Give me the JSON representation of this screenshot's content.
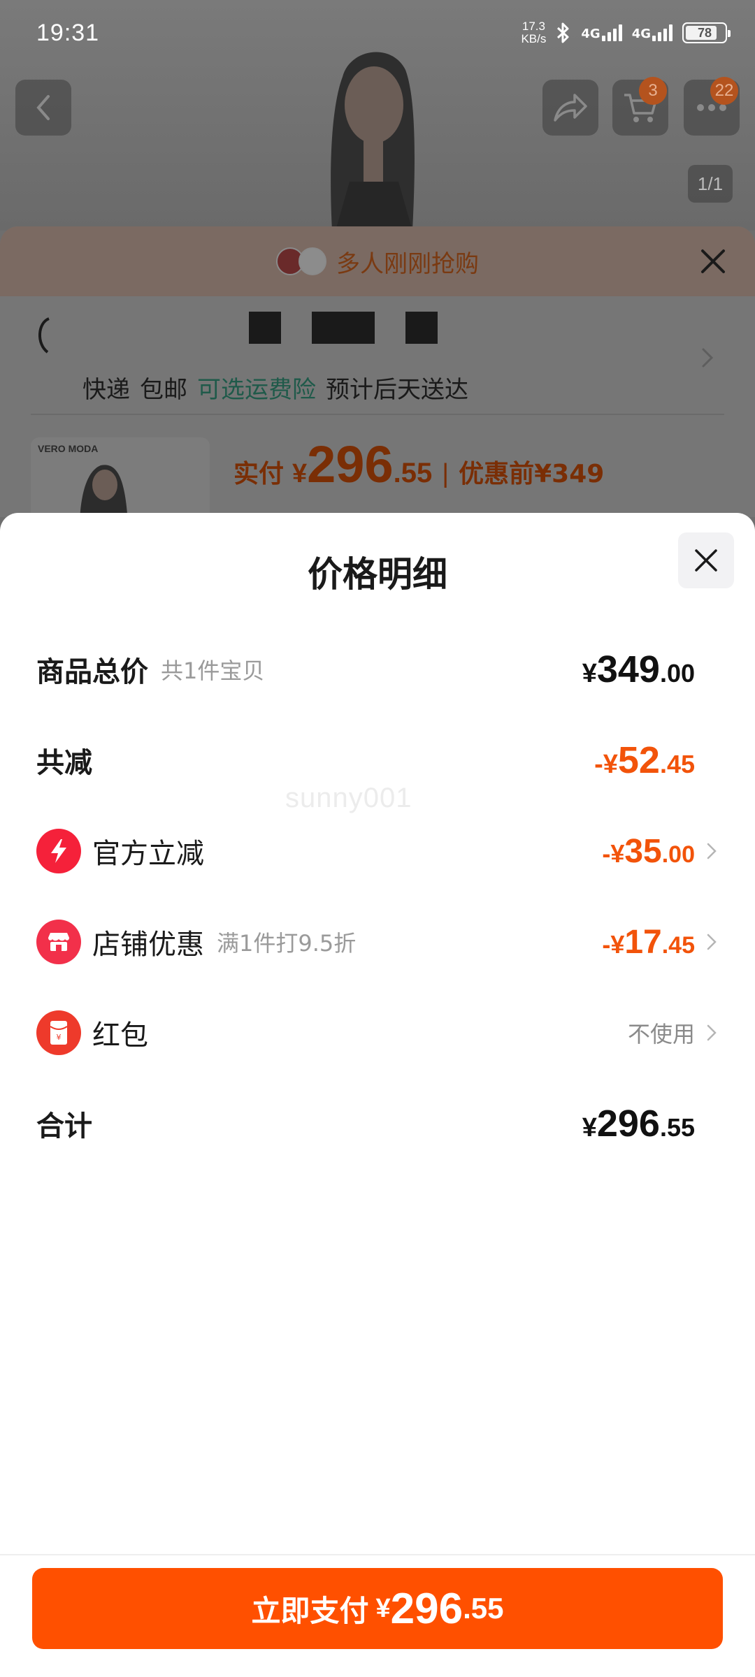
{
  "status_bar": {
    "time": "19:31",
    "net_speed_value": "17.3",
    "net_speed_unit": "KB/s",
    "sim1": "4G",
    "sim2": "4G",
    "battery": "78"
  },
  "product_page": {
    "cart_badge": "3",
    "message_badge": "22",
    "image_indicator": "1/1",
    "promo_text": "多人刚刚抢购",
    "shipping": {
      "method": "快递",
      "free_shipping": "包邮",
      "insurance_link": "可选运费险",
      "eta": "预计后天送达"
    },
    "thumb_brand": "VERO MODA",
    "price": {
      "label": "实付",
      "currency": "¥",
      "integer": "296",
      "decimal": ".55",
      "separator": "|",
      "original": "优惠前¥349"
    }
  },
  "sheet": {
    "title": "价格明细",
    "watermark": "sunny001",
    "rows": [
      {
        "label": "商品总价",
        "sub": "共1件宝贝",
        "currency": "¥",
        "integer": "349",
        "decimal": ".00"
      },
      {
        "label": "共减",
        "currency": "-¥",
        "integer": "52",
        "decimal": ".45"
      },
      {
        "label": "官方立减",
        "icon": "lightning-icon",
        "currency": "-¥",
        "integer": "35",
        "decimal": ".00"
      },
      {
        "label": "店铺优惠",
        "sub": "满1件打9.5折",
        "icon": "store-icon",
        "currency": "-¥",
        "integer": "17",
        "decimal": ".45"
      },
      {
        "label": "红包",
        "icon": "red-packet-icon",
        "value": "不使用"
      },
      {
        "label": "合计",
        "currency": "¥",
        "integer": "296",
        "decimal": ".55"
      }
    ],
    "pay_button": {
      "label": "立即支付",
      "currency": "¥",
      "integer": "296",
      "decimal": ".55"
    }
  },
  "colors": {
    "accent": "#ff5000",
    "discount": "#f2530a",
    "shipping_green": "#1f5a4a"
  }
}
